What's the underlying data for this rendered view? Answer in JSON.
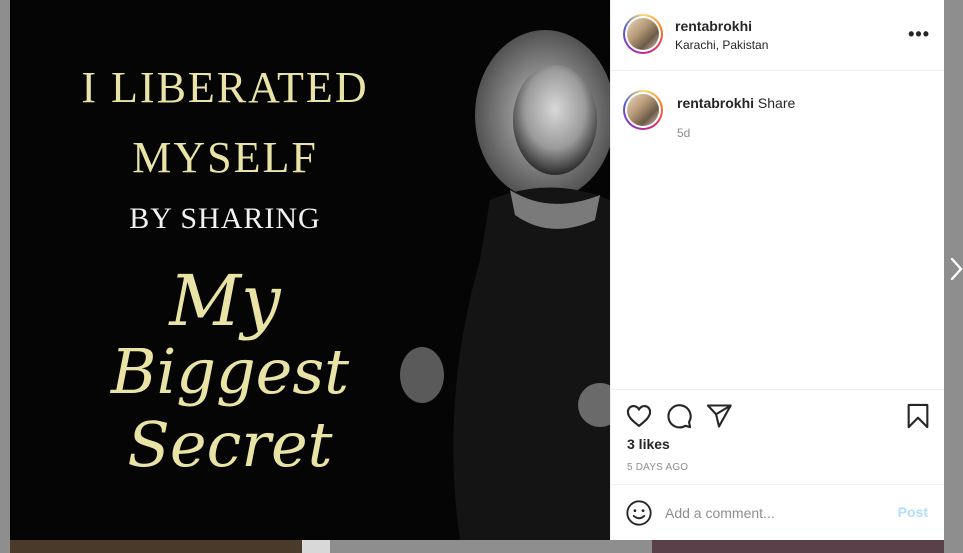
{
  "post": {
    "image_text": {
      "line1": "I LIBERATED",
      "line2": "MYSELF",
      "line3": "BY SHARING",
      "line4": "My",
      "line5": "Biggest Secret"
    }
  },
  "header": {
    "username": "rentabrokhi",
    "location": "Karachi, Pakistan",
    "more_label": "•••"
  },
  "caption": {
    "username": "rentabrokhi",
    "text": "Share",
    "time": "5d"
  },
  "actions": {
    "likes": "3 likes",
    "date": "5 DAYS AGO"
  },
  "comment": {
    "placeholder": "Add a comment...",
    "post_label": "Post"
  },
  "colors": {
    "accent_disabled": "#b2dffc",
    "text": "#262626",
    "muted": "#8e8e8e",
    "image_text": "#e9e3a6"
  },
  "icons": [
    "heart-icon",
    "comment-icon",
    "share-icon",
    "bookmark-icon",
    "emoji-icon",
    "chevron-right-icon"
  ]
}
